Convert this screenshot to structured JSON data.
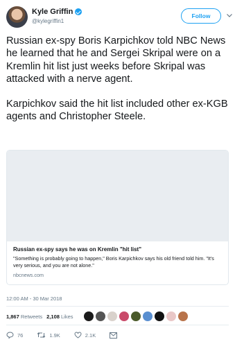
{
  "user": {
    "display_name": "Kyle Griffin",
    "handle": "@kylegriffin1",
    "follow_label": "Follow"
  },
  "tweet": {
    "paragraphs": [
      "Russian ex-spy Boris Karpichkov told NBC News he learned that he and Sergei Skripal were on a Kremlin hit list just weeks before Skripal was attacked with a nerve agent.",
      "Karpichkov said the hit list included other ex-KGB agents and Christopher Steele."
    ]
  },
  "card": {
    "title": "Russian ex-spy says he was on Kremlin \"hit list\"",
    "description": "\"Something is probably going to happen,\" Boris Karpichkov says his old friend told him. \"It's very serious, and you are not alone.\"",
    "domain": "nbcnews.com"
  },
  "timestamp": "12:00 AM - 30 Mar 2018",
  "stats": {
    "retweets_count": "1,867",
    "retweets_label": "Retweets",
    "likes_count": "2,108",
    "likes_label": "Likes"
  },
  "likers": [
    "#1b1b1b",
    "#555555",
    "#d9d2cc",
    "#c94a6a",
    "#4a5a2a",
    "#5a8fd0",
    "#111111",
    "#e9c7c7",
    "#b8734a"
  ],
  "actions": {
    "reply_count": "76",
    "retweet_count": "1.9K",
    "like_count": "2.1K"
  },
  "colors": {
    "accent": "#1da1f2",
    "text": "#14171a",
    "muted": "#657786"
  }
}
